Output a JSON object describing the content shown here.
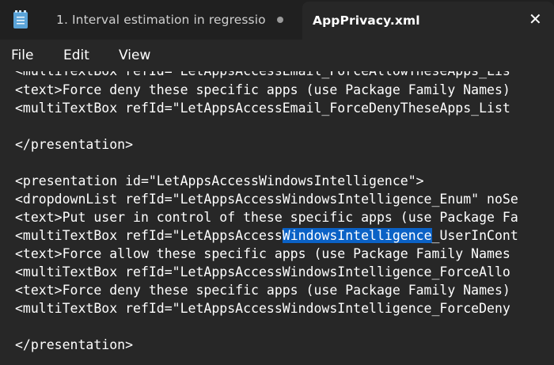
{
  "tabs": [
    {
      "label": "1. Interval estimation in regressio"
    },
    {
      "label": "AppPrivacy.xml",
      "close_glyph": "✕"
    }
  ],
  "menu": [
    "File",
    "Edit",
    "View"
  ],
  "editor": {
    "partial_top_line": "<multiTextBox refId=\"LetAppsAccessEmail_ForceAllowTheseApps_Lis",
    "lines": [
      "<text>Force deny these specific apps (use Package Family Names)",
      "<multiTextBox refId=\"LetAppsAccessEmail_ForceDenyTheseApps_List",
      "",
      "</presentation>",
      "",
      "<presentation id=\"LetAppsAccessWindowsIntelligence\">",
      "<dropdownList refId=\"LetAppsAccessWindowsIntelligence_Enum\" noSe",
      "<text>Put user in control of these specific apps (use Package Fa",
      {
        "before": "<multiTextBox refId=\"LetAppsAccess",
        "selected": "WindowsIntelligence",
        "after": "_UserInCont"
      },
      "<text>Force allow these specific apps (use Package Family Names",
      "<multiTextBox refId=\"LetAppsAccessWindowsIntelligence_ForceAllo",
      "<text>Force deny these specific apps (use Package Family Names)",
      "<multiTextBox refId=\"LetAppsAccessWindowsIntelligence_ForceDeny",
      "",
      "</presentation>"
    ]
  },
  "colors": {
    "selection": "#0b62c6",
    "background": "#272727",
    "tabbar": "#202020"
  },
  "icons": {
    "app": "notepad-icon",
    "modified": "dot-icon",
    "close": "close-icon"
  }
}
